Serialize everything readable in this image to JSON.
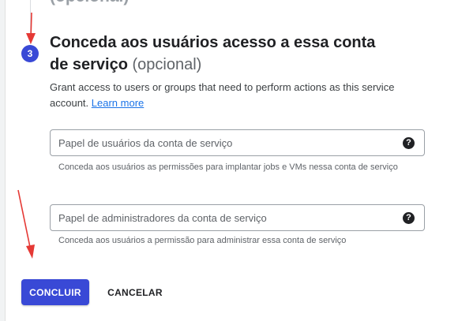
{
  "previous_step": {
    "heading": "(opcional)"
  },
  "step": {
    "number": "3",
    "title": "Conceda aos usuários acesso a essa conta de serviço",
    "title_optional": "(opcional)",
    "description": "Grant access to users or groups that need to perform actions as this service account.",
    "learn_more": "Learn more"
  },
  "fields": {
    "users_role": {
      "placeholder": "Papel de usuários da conta de serviço",
      "value": "",
      "hint": "Conceda aos usuários as permissões para implantar jobs e VMs nessa conta de serviço",
      "help_icon": "?"
    },
    "admins_role": {
      "placeholder": "Papel de administradores da conta de serviço",
      "value": "",
      "hint": "Conceda aos usuários a permissão para administrar essa conta de serviço",
      "help_icon": "?"
    }
  },
  "actions": {
    "done_label": "CONCLUIR",
    "cancel_label": "CANCELAR"
  },
  "colors": {
    "accent": "#3949d6",
    "link": "#1a73e8",
    "annotation_arrow": "#e53935"
  },
  "icons": {
    "help": "help-circle-icon",
    "annotation": "red-arrow-icon"
  }
}
